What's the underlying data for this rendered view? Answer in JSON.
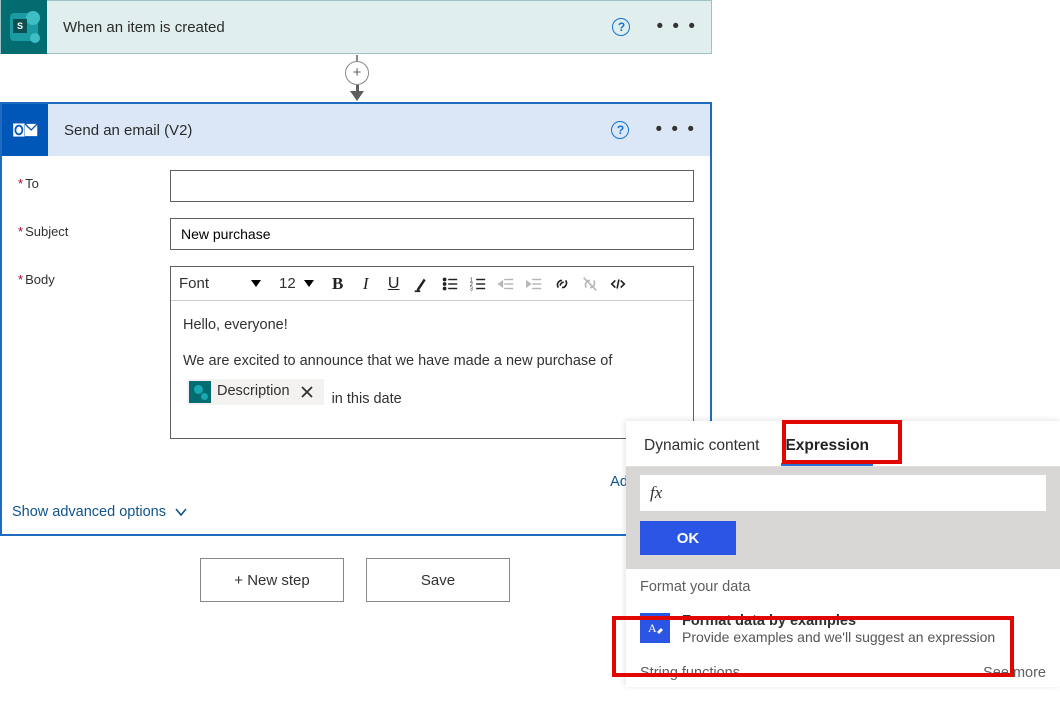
{
  "trigger": {
    "title": "When an item is created"
  },
  "action": {
    "title": "Send an email (V2)",
    "fields": {
      "to_label": "To",
      "subject_label": "Subject",
      "body_label": "Body",
      "subject_value": "New purchase",
      "body_line1": "Hello, everyone!",
      "body_line2": "We are excited to announce that we have made a new purchase of",
      "body_after_token": "in this date"
    },
    "token": {
      "label": "Description"
    },
    "toolbar": {
      "font_label": "Font",
      "size_label": "12"
    },
    "add_dynamic_label": "Add dynamic",
    "advanced_label": "Show advanced options"
  },
  "footer": {
    "new_step": "+ New step",
    "save": "Save"
  },
  "expression_panel": {
    "tab_dynamic": "Dynamic content",
    "tab_expression": "Expression",
    "fx_label": "fx",
    "ok_label": "OK",
    "section_format": "Format your data",
    "format_item_title": "Format data by examples",
    "format_item_desc": "Provide examples and we'll suggest an expression",
    "string_funcs": "String functions",
    "see_more": "See more"
  }
}
